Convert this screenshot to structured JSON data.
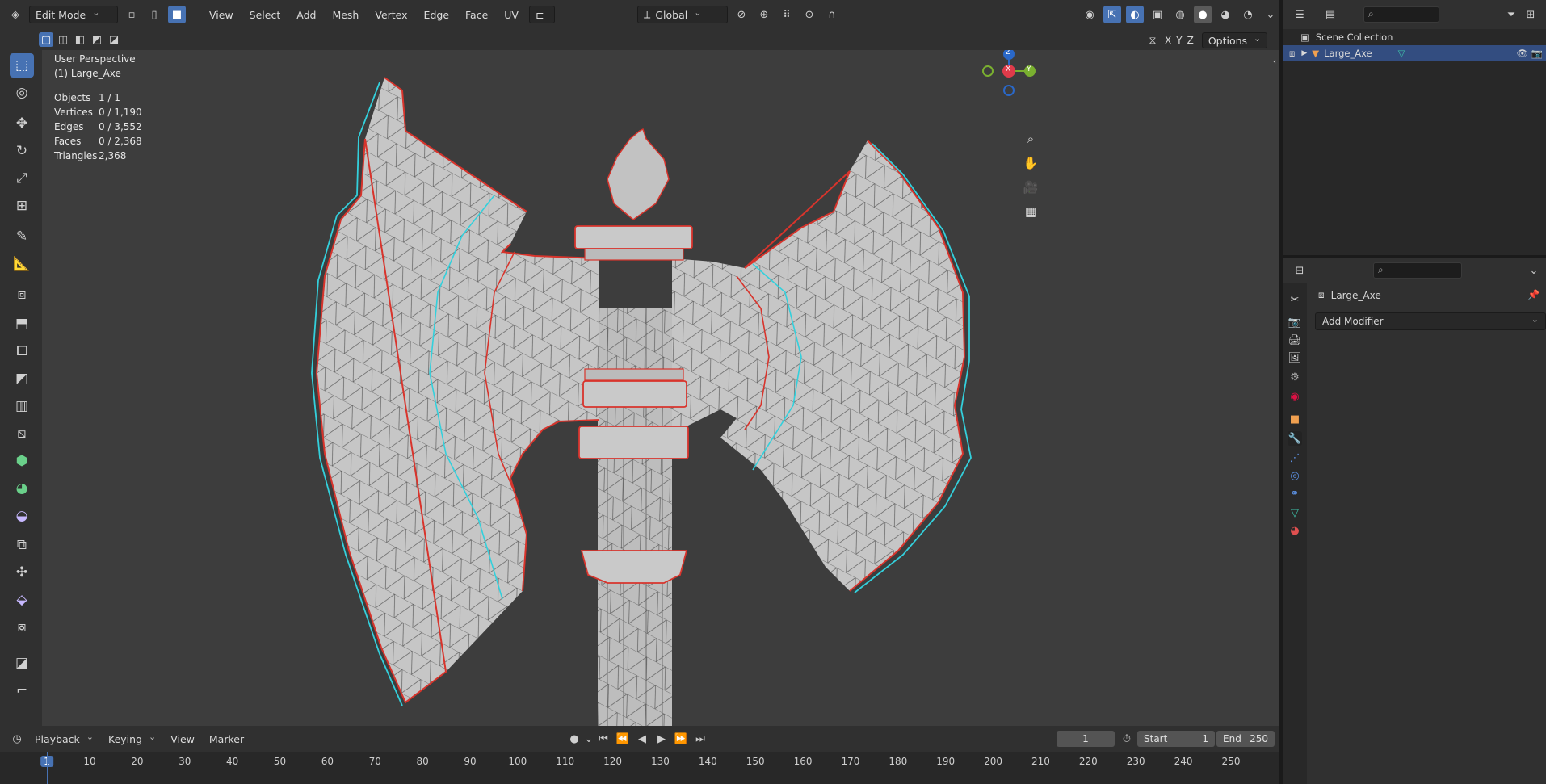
{
  "header": {
    "mode": "Edit Mode",
    "menus": [
      "View",
      "Select",
      "Add",
      "Mesh",
      "Vertex",
      "Edge",
      "Face",
      "UV"
    ],
    "orientation": "Global",
    "options_label": "Options",
    "axis_x": "X",
    "axis_y": "Y",
    "axis_z": "Z"
  },
  "viewport": {
    "perspective": "User Perspective",
    "object_label": "(1) Large_Axe",
    "stats": [
      {
        "label": "Objects",
        "value": "1 / 1"
      },
      {
        "label": "Vertices",
        "value": "0 / 1,190"
      },
      {
        "label": "Edges",
        "value": "0 / 3,552"
      },
      {
        "label": "Faces",
        "value": "0 / 2,368"
      },
      {
        "label": "Triangles",
        "value": "2,368"
      }
    ],
    "gizmo": {
      "x": "X",
      "y": "Y",
      "z": "Z"
    }
  },
  "timeline": {
    "menus": [
      "Playback",
      "Keying",
      "View",
      "Marker"
    ],
    "current_frame": "1",
    "start_label": "Start",
    "start": "1",
    "end_label": "End",
    "end": "250",
    "ticks": [
      "1",
      "10",
      "20",
      "30",
      "40",
      "50",
      "60",
      "70",
      "80",
      "90",
      "100",
      "110",
      "120",
      "130",
      "140",
      "150",
      "160",
      "170",
      "180",
      "190",
      "200",
      "210",
      "220",
      "230",
      "240",
      "250"
    ]
  },
  "outliner": {
    "root": "Scene Collection",
    "object": "Large_Axe"
  },
  "properties": {
    "object_name": "Large_Axe",
    "add_modifier": "Add Modifier"
  },
  "colors": {
    "accent": "#4772b3",
    "seam": "#d8342c",
    "sharp": "#33d0dc",
    "mesh_fill": "#c6c6c6",
    "viewport_bg": "#3d3d3d"
  }
}
